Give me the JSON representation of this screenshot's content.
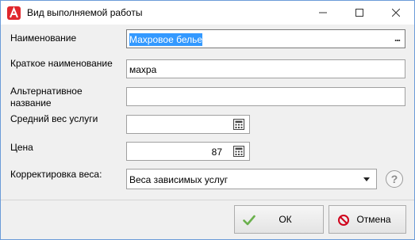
{
  "window": {
    "title": "Вид выполняемой работы"
  },
  "form": {
    "name": {
      "label": "Наименование",
      "value": "Махровое белье",
      "button": "..."
    },
    "short_name": {
      "label": "Краткое наименование",
      "value": "махра"
    },
    "alt_name": {
      "label_line1": "Альтернативное",
      "label_line2": "название",
      "value": ""
    },
    "avg_weight": {
      "label": "Средний вес услуги",
      "value": ""
    },
    "price": {
      "label": "Цена",
      "value": "87"
    },
    "weight_correction": {
      "label": "Корректировка веса:",
      "selected": "Веса зависимых услуг"
    },
    "help": "?"
  },
  "footer": {
    "ok_label": "ОК",
    "cancel_label": "Отмена"
  },
  "colors": {
    "selection": "#3399ff",
    "ok_check": "#6ab04c",
    "cancel_icon": "#d0021b",
    "app_icon": "#e0282e"
  }
}
